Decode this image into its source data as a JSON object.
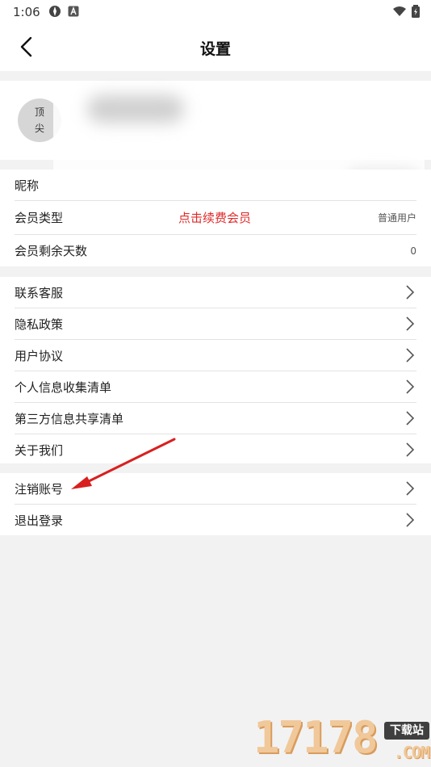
{
  "status_bar": {
    "time": "1:06",
    "icons_left": [
      "settings-gear-icon",
      "a-badge-icon"
    ],
    "icons_right": [
      "wifi-icon",
      "battery-charging-icon"
    ]
  },
  "nav": {
    "title": "设置",
    "back_icon": "chevron-left-icon"
  },
  "profile": {
    "avatar_line1": "顶",
    "avatar_line2": "尖"
  },
  "account_section": [
    {
      "label": "昵称",
      "value": ""
    },
    {
      "label": "会员类型",
      "center": "点击续费会员",
      "value": "普通用户"
    },
    {
      "label": "会员剩余天数",
      "value": "0"
    }
  ],
  "info_section": [
    {
      "label": "联系客服"
    },
    {
      "label": "隐私政策"
    },
    {
      "label": "用户协议"
    },
    {
      "label": "个人信息收集清单"
    },
    {
      "label": "第三方信息共享清单"
    },
    {
      "label": "关于我们"
    }
  ],
  "action_section": [
    {
      "label": "注销账号"
    },
    {
      "label": "退出登录"
    }
  ],
  "watermark": {
    "number": "17178",
    "tag": "下载站",
    "domain": ".COM"
  },
  "colors": {
    "accent_red": "#e02a2a",
    "background": "#f2f2f2",
    "row_bg": "#ffffff",
    "divider": "#e3e3e3"
  }
}
